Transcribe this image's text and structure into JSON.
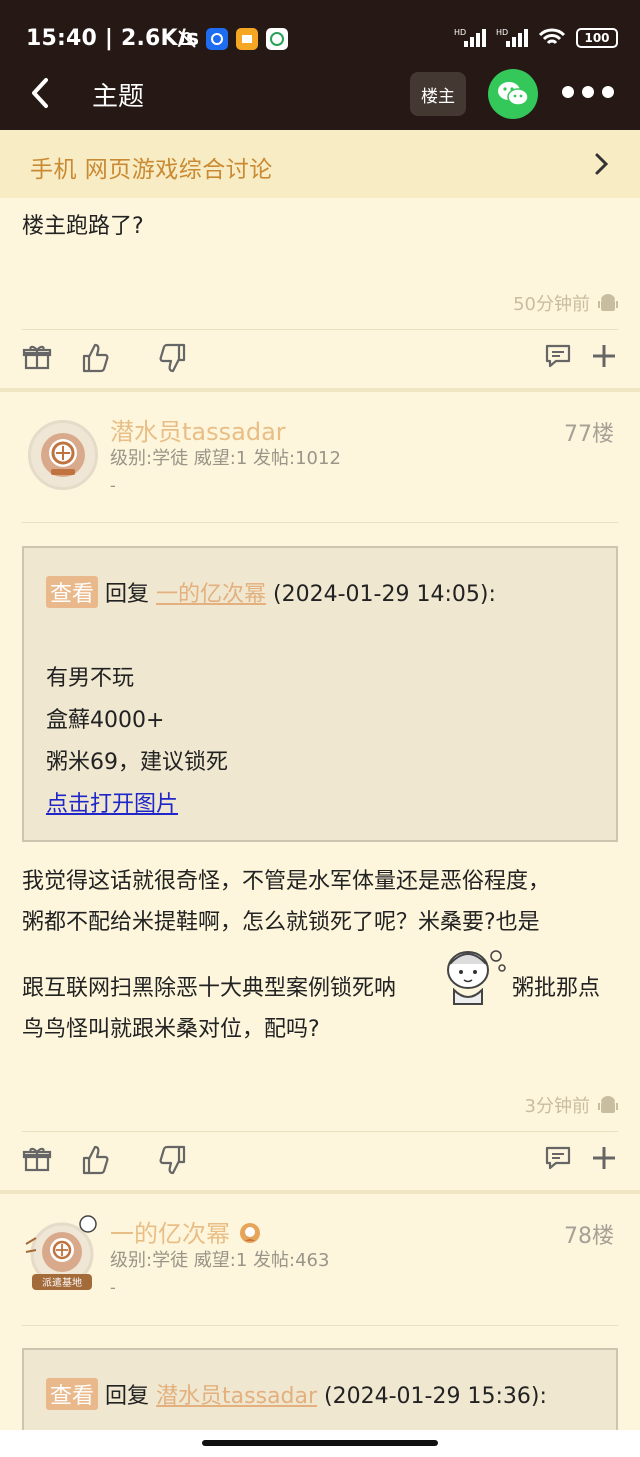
{
  "status_bar": {
    "time": "15:40 | 2.6K/s",
    "battery": "100"
  },
  "nav": {
    "title": "主题",
    "louzhu_button": "楼主"
  },
  "forum": {
    "name": "手机 网页游戏综合讨论"
  },
  "post_prev": {
    "text": "楼主跑路了?",
    "time": "50分钟前"
  },
  "post77": {
    "username": "潜水员tassadar",
    "stats": "级别:学徒 威望:1 发帖:1012",
    "dash": "-",
    "floor": "77楼",
    "quote": {
      "view_label": "查看",
      "reply_prefix": "回复",
      "reply_user": "一的亿次幂",
      "reply_time": "(2024-01-29 14:05):",
      "lines": [
        "有男不玩",
        "盒蘚4000+",
        "粥米69，建议锁死"
      ],
      "open_image": "点击打开图片"
    },
    "body_lines": [
      "我觉得这话就很奇怪，不管是水军体量还是恶俗程度，",
      "粥都不配给米提鞋啊，怎么就锁死了呢？米桑要?也是",
      "跟互联网扫黑除恶十大典型案例锁死呐",
      "粥批那点",
      "鸟鸟怪叫就跟米桑对位，配吗?"
    ],
    "time": "3分钟前"
  },
  "post78": {
    "username": "一的亿次幂",
    "stats": "级别:学徒 威望:1 发帖:463",
    "dash": "-",
    "floor": "78楼",
    "avatar_caption": "派遣基地",
    "quote": {
      "view_label": "查看",
      "reply_prefix": "回复",
      "reply_user": "潜水员tassadar",
      "reply_time": "(2024-01-29 15:36):"
    }
  },
  "colors": {
    "bg": "#fdf6dc",
    "header": "#261815",
    "accent": "#c98a33",
    "username": "#e9be86",
    "wechat": "#34c759"
  },
  "icons": [
    "back-arrow-icon",
    "wechat-icon",
    "more-icon",
    "chevron-right-icon",
    "gift-icon",
    "thumbs-up-icon",
    "thumbs-down-icon",
    "comment-icon",
    "plus-icon",
    "android-icon"
  ]
}
